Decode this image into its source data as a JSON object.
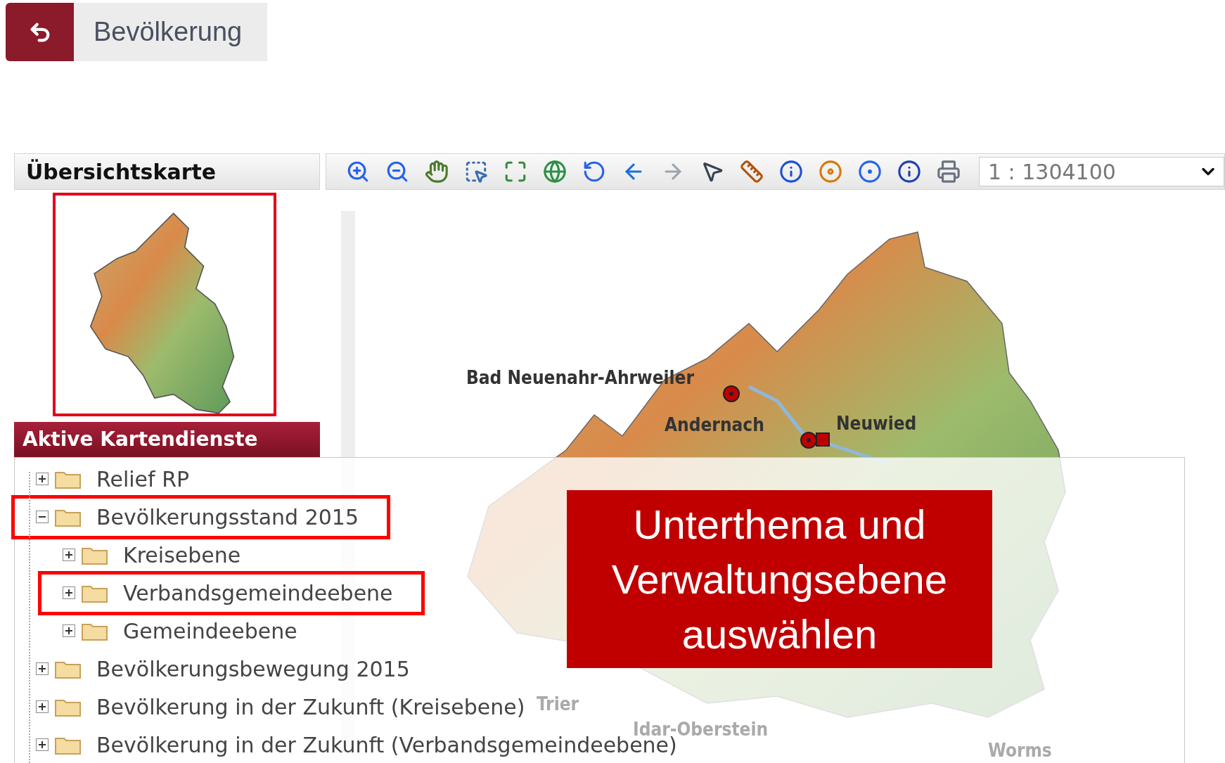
{
  "header": {
    "title": "Bevölkerung"
  },
  "overview": {
    "title": "Übersichtskarte"
  },
  "toolbar": {
    "scale": "1 : 1304100"
  },
  "map": {
    "labels": [
      {
        "text": "Bad Neuenahr-Ahrweiler",
        "faded": false
      },
      {
        "text": "Andernach",
        "faded": false
      },
      {
        "text": "Neuwied",
        "faded": false
      },
      {
        "text": "Trier",
        "faded": true
      },
      {
        "text": "Idar-Oberstein",
        "faded": true
      },
      {
        "text": "Worms",
        "faded": true
      }
    ]
  },
  "layers": {
    "title": "Aktive Kartendienste",
    "items": [
      {
        "label": "Relief RP",
        "expanded": false,
        "highlighted": false
      },
      {
        "label": "Bevölkerungsstand 2015",
        "expanded": true,
        "highlighted": true,
        "children": [
          {
            "label": "Kreisebene",
            "expanded": false,
            "highlighted": false
          },
          {
            "label": "Verbandsgemeindeebene",
            "expanded": false,
            "highlighted": true
          },
          {
            "label": "Gemeindeebene",
            "expanded": false,
            "highlighted": false
          }
        ]
      },
      {
        "label": "Bevölkerungsbewegung 2015",
        "expanded": false,
        "highlighted": false
      },
      {
        "label": "Bevölkerung in der Zukunft (Kreisebene)",
        "expanded": false,
        "highlighted": false
      },
      {
        "label": "Bevölkerung in der Zukunft (Verbandsgemeindeebene)",
        "expanded": false,
        "highlighted": false
      }
    ]
  },
  "callout": {
    "text": "Unterthema und Verwaltungsebene auswählen"
  }
}
